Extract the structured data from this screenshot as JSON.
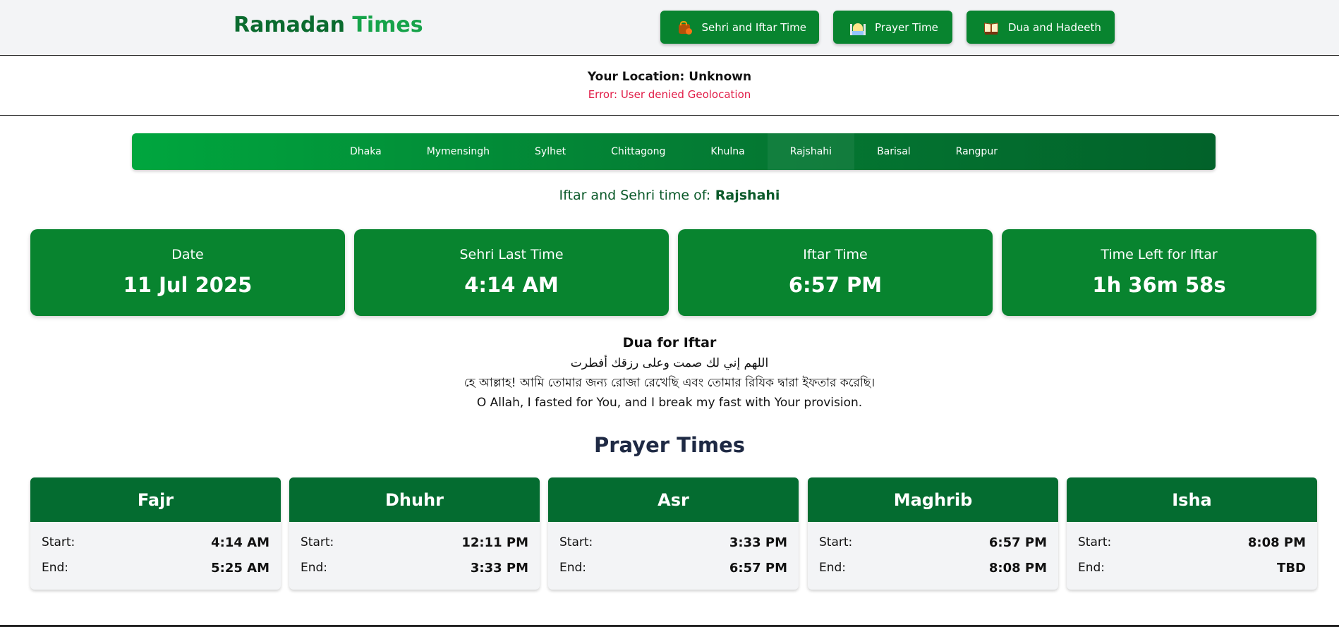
{
  "header": {
    "brand_part1": "Ramadan",
    "brand_part2": "Times",
    "nav": [
      {
        "label": "Sehri and Iftar Time",
        "icon": "food-bag-icon"
      },
      {
        "label": "Prayer Time",
        "icon": "mosque-icon"
      },
      {
        "label": "Dua and Hadeeth",
        "icon": "open-book-icon"
      }
    ]
  },
  "location": {
    "text": "Your Location: Unknown",
    "error": "Error: User denied Geolocation"
  },
  "cities": [
    "Dhaka",
    "Mymensingh",
    "Sylhet",
    "Chittagong",
    "Khulna",
    "Rajshahi",
    "Barisal",
    "Rangpur"
  ],
  "selected_city": "Rajshahi",
  "selected_label": "Iftar and Sehri time of:",
  "info_cards": [
    {
      "title": "Date",
      "value": "11 Jul 2025"
    },
    {
      "title": "Sehri Last Time",
      "value": "4:14 AM"
    },
    {
      "title": "Iftar Time",
      "value": "6:57 PM"
    },
    {
      "title": "Time Left for Iftar",
      "value": "1h 36m 58s"
    }
  ],
  "dua": {
    "title": "Dua for Iftar",
    "arabic": "اللهم إني لك صمت وعلى رزقك أفطرت",
    "bengali": "হে আল্লাহ! আমি তোমার জন্য রোজা রেখেছি এবং তোমার রিযিক দ্বারা ইফতার করেছি।",
    "english": "O Allah, I fasted for You, and I break my fast with Your provision."
  },
  "prayer_times": {
    "title": "Prayer Times",
    "start_label": "Start:",
    "end_label": "End:",
    "items": [
      {
        "name": "Fajr",
        "start": "4:14 AM",
        "end": "5:25 AM"
      },
      {
        "name": "Dhuhr",
        "start": "12:11 PM",
        "end": "3:33 PM"
      },
      {
        "name": "Asr",
        "start": "3:33 PM",
        "end": "6:57 PM"
      },
      {
        "name": "Maghrib",
        "start": "6:57 PM",
        "end": "8:08 PM"
      },
      {
        "name": "Isha",
        "start": "8:08 PM",
        "end": "TBD"
      }
    ]
  },
  "colors": {
    "primary_green": "#08842f",
    "dark_green": "#046c30",
    "error_red": "#e11d48"
  }
}
